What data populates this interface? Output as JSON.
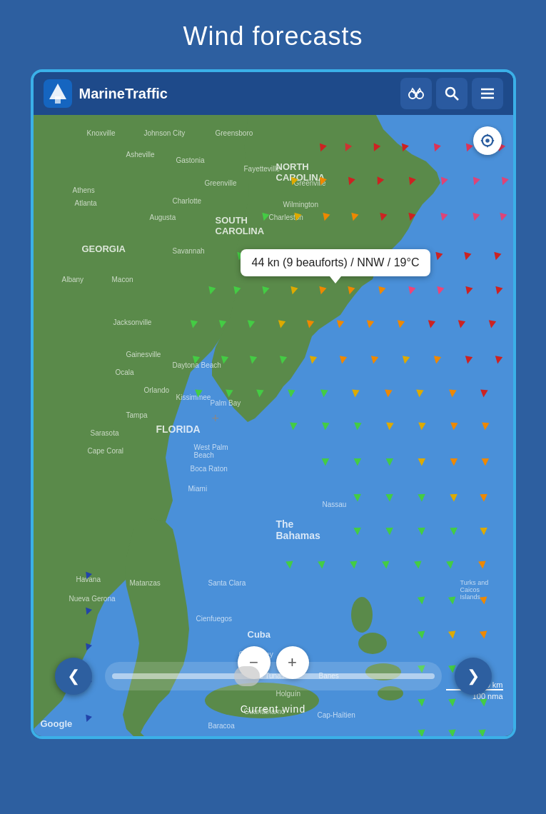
{
  "page": {
    "title": "Wind forecasts"
  },
  "header": {
    "app_name": "MarineTraffic",
    "binoculars_icon": "binoculars",
    "search_icon": "search",
    "menu_icon": "menu"
  },
  "map": {
    "tooltip_text": "44 kn (9 beauforts) / NNW / 19°C",
    "bottom_label": "Current wind",
    "scale_200": "200 km",
    "scale_100": "100 nma",
    "google_label": "Google"
  },
  "controls": {
    "zoom_in": "+",
    "zoom_out": "−",
    "prev_arrow": "❮",
    "next_arrow": "❯"
  }
}
